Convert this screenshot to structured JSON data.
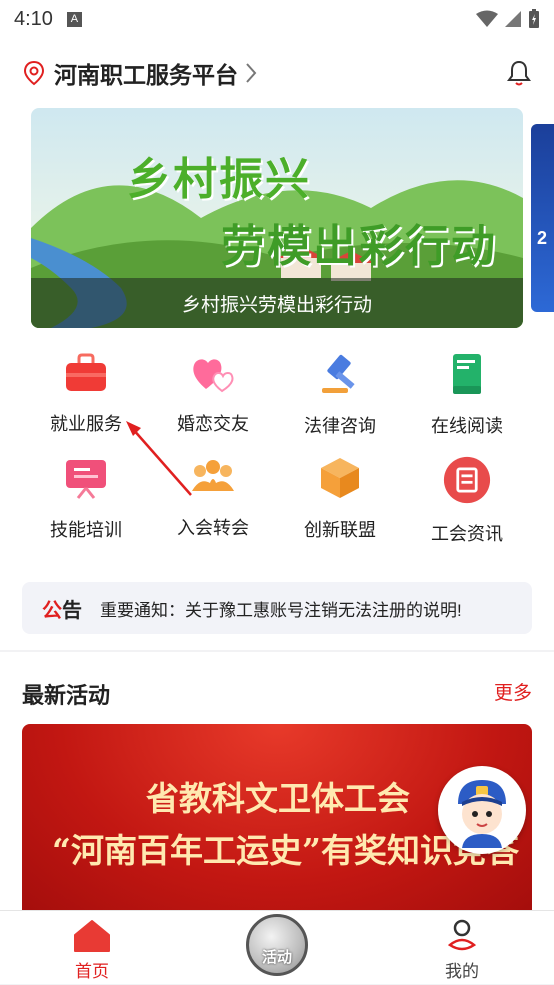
{
  "status_bar": {
    "time": "4:10"
  },
  "header": {
    "title": "河南职工服务平台"
  },
  "banner": {
    "headline1": "乡村振兴",
    "headline2": "劳模出彩行动",
    "caption": "乡村振兴劳模出彩行动",
    "next_label": "2"
  },
  "services": [
    {
      "label": "就业服务",
      "icon": "briefcase-icon",
      "color": "#e8322f"
    },
    {
      "label": "婚恋交友",
      "icon": "hearts-icon",
      "color": "#ff6b9b"
    },
    {
      "label": "法律咨询",
      "icon": "gavel-icon",
      "color": "#3f6fd8"
    },
    {
      "label": "在线阅读",
      "icon": "book-icon",
      "color": "#23b26a"
    },
    {
      "label": "技能培训",
      "icon": "training-board-icon",
      "color": "#f0507a"
    },
    {
      "label": "入会转会",
      "icon": "group-icon",
      "color": "#f5a03a"
    },
    {
      "label": "创新联盟",
      "icon": "cube-icon",
      "color": "#f5a03a"
    },
    {
      "label": "工会资讯",
      "icon": "news-icon",
      "color": "#e84b4b"
    }
  ],
  "notice": {
    "tag_prefix": "公",
    "tag_suffix": "告",
    "message": "重要通知：关于豫工惠账号注销无法注册的说明!"
  },
  "activities": {
    "heading": "最新活动",
    "more": "更多",
    "banner_line1": "省教科文卫体工会",
    "banner_line2": "“河南百年工运史”有奖知识竞答"
  },
  "tabbar": {
    "home": "首页",
    "center": "活动",
    "mine": "我的"
  },
  "colors": {
    "accent": "#e02020"
  }
}
